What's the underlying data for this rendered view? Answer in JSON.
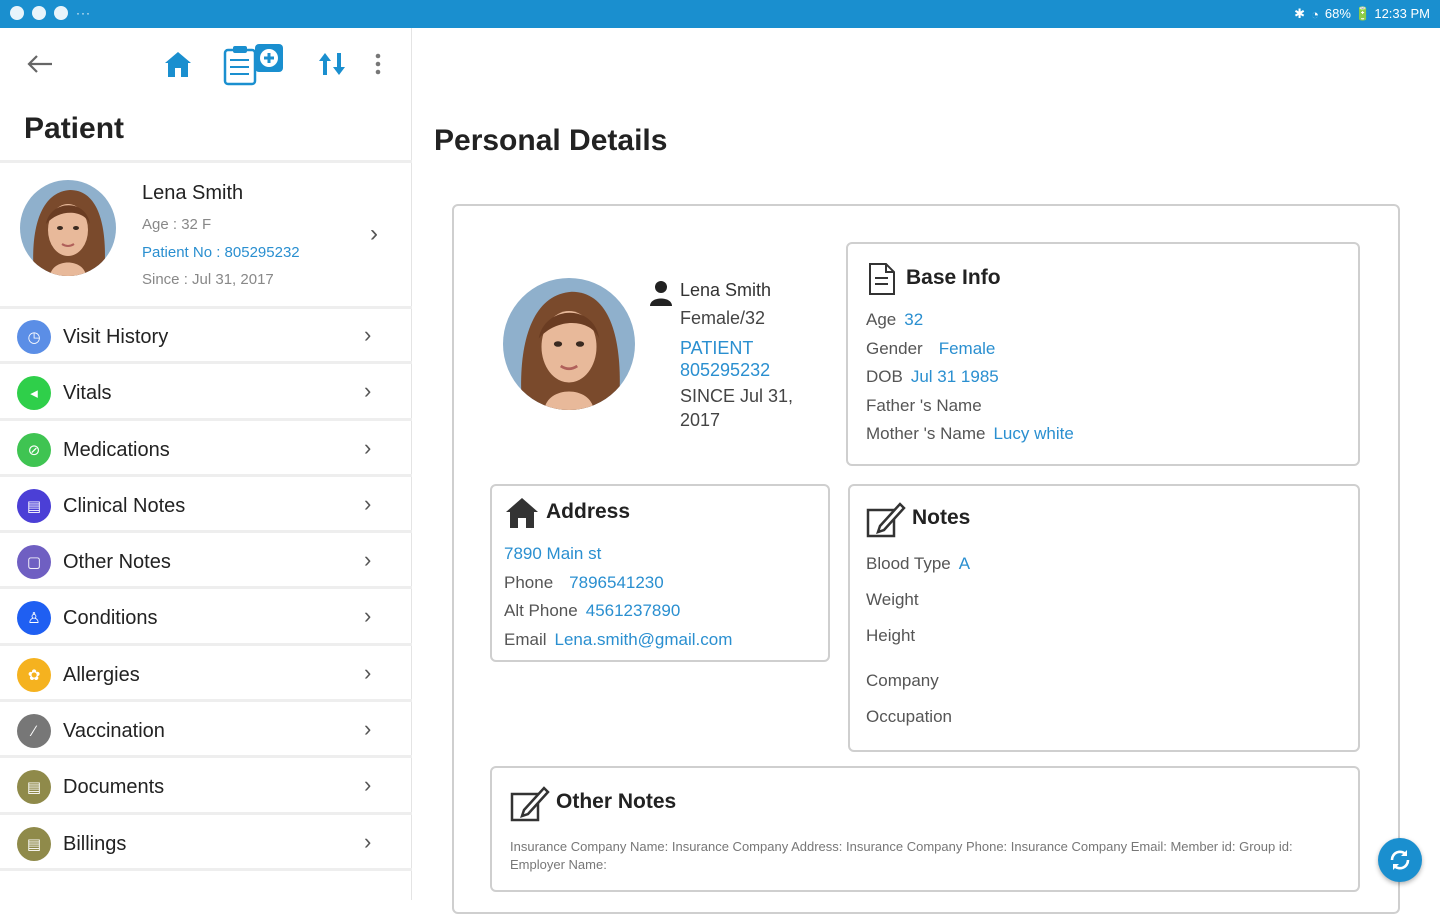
{
  "status_bar": {
    "right_text": "68% 🔋 12:33 PM",
    "more": "···"
  },
  "colors": {
    "accent": "#1a8fcf",
    "link": "#2a8fd0"
  },
  "sidebar": {
    "title": "Patient",
    "patient": {
      "name": "Lena Smith",
      "age": "Age : 32 F",
      "patient_no": "Patient No : 805295232",
      "since": "Since : Jul 31, 2017"
    },
    "menu": [
      {
        "label": "Visit History",
        "icon": "clock-icon",
        "color": "#5b8ee6"
      },
      {
        "label": "Vitals",
        "icon": "vitals-icon",
        "color": "#2fcf4a"
      },
      {
        "label": "Medications",
        "icon": "pill-icon",
        "color": "#3fc452"
      },
      {
        "label": "Clinical Notes",
        "icon": "document-icon",
        "color": "#4b3fd6"
      },
      {
        "label": "Other Notes",
        "icon": "document-icon",
        "color": "#6f5fc2"
      },
      {
        "label": "Conditions",
        "icon": "person-icon",
        "color": "#1f5ff2"
      },
      {
        "label": "Allergies",
        "icon": "allergy-icon",
        "color": "#f5b21f"
      },
      {
        "label": "Vaccination",
        "icon": "syringe-icon",
        "color": "#777777"
      },
      {
        "label": "Documents",
        "icon": "document-icon",
        "color": "#8f8a4a"
      },
      {
        "label": "Billings",
        "icon": "document-icon",
        "color": "#8f8a4a"
      }
    ]
  },
  "main": {
    "title": "Personal Details",
    "identity": {
      "name": "Lena Smith",
      "gender_age": "Female/32",
      "patient_label": "PATIENT",
      "patient_no": "805295232",
      "since": "SINCE Jul 31, 2017"
    },
    "base_info": {
      "title": "Base Info",
      "age_label": "Age",
      "age": "32",
      "gender_label": "Gender",
      "gender": "Female",
      "dob_label": "DOB",
      "dob": "Jul 31 1985",
      "father_label": "Father 's Name",
      "father": "",
      "mother_label": "Mother 's Name",
      "mother": "Lucy white"
    },
    "address": {
      "title": "Address",
      "street": "7890 Main st",
      "phone_label": "Phone",
      "phone": "7896541230",
      "alt_phone_label": "Alt Phone",
      "alt_phone": "4561237890",
      "email_label": "Email",
      "email": "Lena.smith@gmail.com"
    },
    "notes": {
      "title": "Notes",
      "blood_label": "Blood Type",
      "blood": "A",
      "weight_label": "Weight",
      "height_label": "Height",
      "company_label": "Company",
      "occupation_label": "Occupation"
    },
    "other_notes": {
      "title": "Other Notes",
      "text": "Insurance Company Name: Insurance Company Address: Insurance Company Phone: Insurance Company Email: Member id: Group id: Employer Name:"
    }
  }
}
